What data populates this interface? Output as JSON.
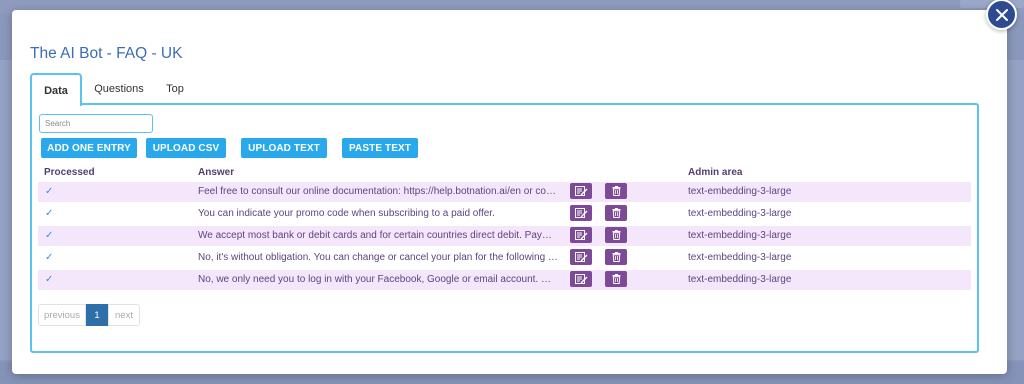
{
  "modal": {
    "title": "The AI Bot - FAQ - UK",
    "close_icon": "close-icon"
  },
  "tabs": [
    {
      "label": "Data",
      "active": true
    },
    {
      "label": "Questions",
      "active": false
    },
    {
      "label": "Top",
      "active": false
    }
  ],
  "search": {
    "placeholder": "Search",
    "value": ""
  },
  "actions": {
    "add_one_entry": "ADD ONE ENTRY",
    "upload_csv": "UPLOAD CSV",
    "upload_text": "UPLOAD TEXT",
    "paste_text": "PASTE TEXT"
  },
  "table": {
    "headers": {
      "processed": "Processed",
      "answer": "Answer",
      "admin_area": "Admin area"
    },
    "rows": [
      {
        "processed": "✓",
        "answer": "Feel free to consult our online documentation: https://help.botnation.ai/en or contact us via ...",
        "admin_area": "text-embedding-3-large"
      },
      {
        "processed": "✓",
        "answer": "You can indicate your promo code when subscribing to a paid offer.",
        "admin_area": "text-embedding-3-large"
      },
      {
        "processed": "✓",
        "answer": "We accept most bank or debit cards and for certain countries direct debit. Payments are ma...",
        "admin_area": "text-embedding-3-large"
      },
      {
        "processed": "✓",
        "answer": "No, it's without obligation. You can change or cancel your plan for the following month when...",
        "admin_area": "text-embedding-3-large"
      },
      {
        "processed": "✓",
        "answer": "No, we only need you to log in with your Facebook, Google or email account. We are compati...",
        "admin_area": "text-embedding-3-large"
      }
    ]
  },
  "pagination": {
    "previous": "previous",
    "current": "1",
    "next": "next"
  },
  "colors": {
    "accent": "#29a8ec",
    "title": "#3b6db5",
    "row_highlight": "#f4e7fb",
    "action_icon_bg": "#7c4a96",
    "pager_active": "#2e6faa"
  }
}
